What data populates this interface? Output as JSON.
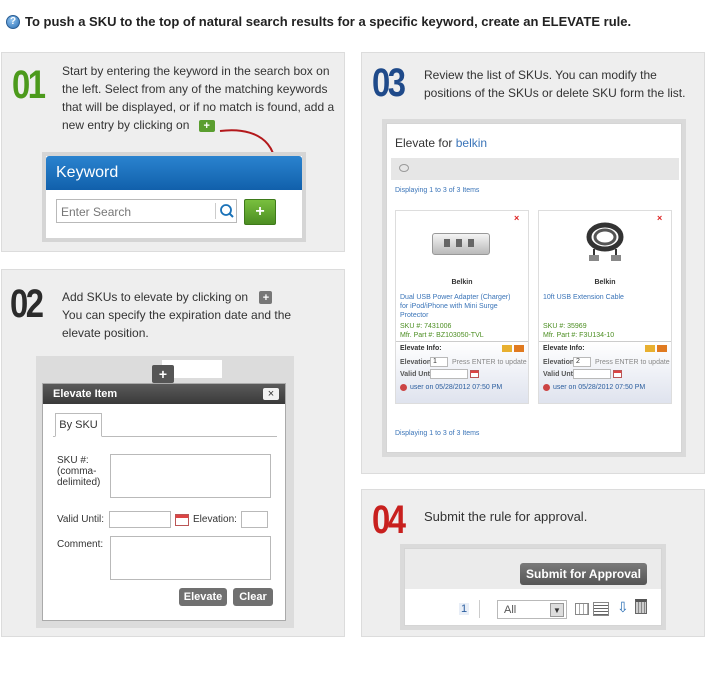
{
  "header": {
    "text": "To push a SKU to the top of natural search results for a specific keyword, create an ELEVATE rule."
  },
  "step1": {
    "number": "01",
    "text": "Start by entering the keyword in the search box on the left. Select from any of the matching keywords that will be displayed, or if no match is found, add a new entry by clicking on",
    "keyword_title": "Keyword",
    "search_placeholder": "Enter Search",
    "add_label": "+"
  },
  "step2": {
    "number": "02",
    "text1": "Add SKUs to elevate by clicking on",
    "text2": "You can specify the expiration date and the elevate position.",
    "dialog_title": "Elevate Item",
    "tab_label": "By SKU",
    "sku_label": "SKU #:\n(comma-\ndelimited)",
    "valid_until_label": "Valid Until:",
    "elevation_label": "Elevation:",
    "comment_label": "Comment:",
    "elevate_button": "Elevate",
    "clear_button": "Clear",
    "plus": "+",
    "close": "×"
  },
  "step3": {
    "number": "03",
    "text": "Review the list of SKUs. You can modify the positions of the SKUs or delete SKU form the list.",
    "title_prefix": "Elevate for",
    "keyword": "belkin",
    "displaying_top": "Displaying 1 to 3 of 3 Items",
    "displaying_bottom": "Displaying 1 to 3 of 3 Items",
    "items": [
      {
        "brand": "Belkin",
        "name": "Dual USB Power Adapter (Charger) for iPod/iPhone with Mini Surge Protector",
        "sku": "SKU #: 7431006",
        "mfr": "Mfr. Part #: BZ103050-TVL",
        "info_label": "Elevate Info:",
        "elevation_label": "Elevation",
        "elevation_value": "1",
        "enter_hint": "Press ENTER to update",
        "valid_label": "Valid Until",
        "user_line": "user on 05/28/2012 07:50 PM"
      },
      {
        "brand": "Belkin",
        "name": "10ft USB Extension Cable",
        "sku": "SKU #: 35969",
        "mfr": "Mfr. Part #: F3U134-10",
        "info_label": "Elevate Info:",
        "elevation_label": "Elevation",
        "elevation_value": "2",
        "enter_hint": "Press ENTER to update",
        "valid_label": "Valid Until",
        "user_line": "user on 05/28/2012 07:50 PM"
      }
    ]
  },
  "step4": {
    "number": "04",
    "text": "Submit the rule for approval.",
    "submit_button": "Submit for Approval",
    "page_number": "1",
    "filter_value": "All"
  },
  "colors": {
    "green": "#5a9e2f",
    "blue": "#1f4a8a",
    "red": "#c8201e",
    "dark": "#2b2b2b",
    "keyword_bar": "#1769b5"
  }
}
